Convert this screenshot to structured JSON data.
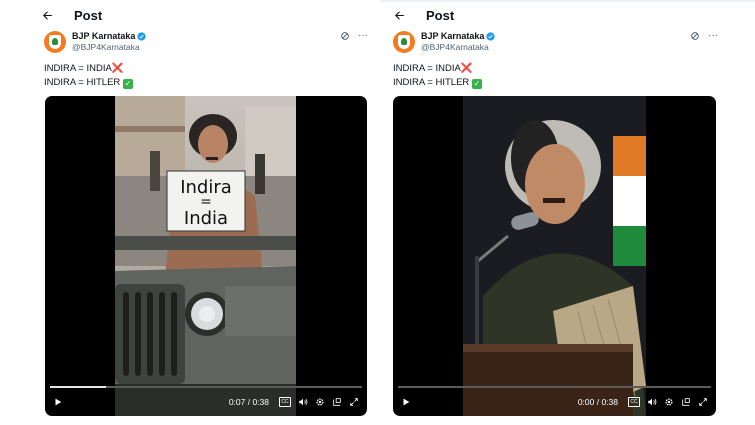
{
  "posts": [
    {
      "header_title": "Post",
      "author_name": "BJP Karnataka",
      "author_handle": "@BJP4Karnataka",
      "line1": "INDIRA = INDIA",
      "line1_mark": "❌",
      "line2": "INDIRA = HITLER",
      "line2_mark": "✓",
      "sign_top": "Indira",
      "sign_eq": "=",
      "sign_bottom": "India",
      "video_time": "0:07 / 0:38",
      "video_progress": 0.18
    },
    {
      "header_title": "Post",
      "author_name": "BJP Karnataka",
      "author_handle": "@BJP4Karnataka",
      "line1": "INDIRA = INDIA",
      "line1_mark": "❌",
      "line2": "INDIRA = HITLER",
      "line2_mark": "✓",
      "video_time": "0:00 / 0:38",
      "video_progress": 0.0
    }
  ],
  "icons": {
    "back": "arrow-left-icon",
    "verified": "verified-badge-icon",
    "grok": "grok-icon",
    "more": "more-icon",
    "play": "play-icon",
    "captions": "captions-icon",
    "volume": "volume-icon",
    "settings": "settings-icon",
    "pip": "picture-in-picture-icon",
    "fullscreen": "fullscreen-icon"
  },
  "colors": {
    "verified": "#1d9bf0",
    "avatar": "#f47b20",
    "video_bg": "#000000"
  }
}
